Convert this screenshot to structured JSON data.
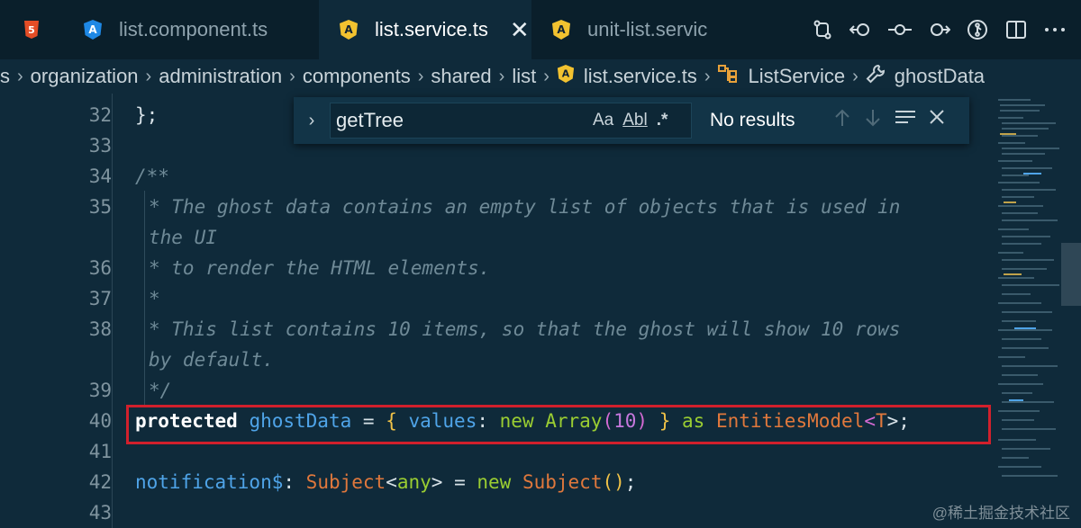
{
  "tabs": [
    {
      "label": "",
      "icon": "html5-icon"
    },
    {
      "label": "list.component.ts",
      "icon": "angular-icon"
    },
    {
      "label": "list.service.ts",
      "icon": "angular-icon",
      "active": true
    },
    {
      "label": "unit-list.servic",
      "icon": "angular-icon"
    }
  ],
  "tab_close": "✕",
  "breadcrumb": {
    "lead": "s",
    "items": [
      "organization",
      "administration",
      "components",
      "shared",
      "list",
      "list.service.ts",
      "ListService",
      "ghostData"
    ]
  },
  "find": {
    "query": "getTree",
    "opt_case": "Aa",
    "opt_word": "Abl",
    "opt_regex": ".*",
    "results": "No results"
  },
  "code": {
    "line32": "};",
    "line34": "/**",
    "line35a": "* The ghost data contains an empty list of objects that is used in",
    "line35b": "the UI",
    "line36": "* to render the HTML elements.",
    "line37": "*",
    "line38a": "* This list contains 10 items, so that the ghost will show 10 rows",
    "line38b": "by default.",
    "line39": "*/",
    "l40": {
      "kw": "protected",
      "name": "ghostData",
      "eq": " = ",
      "open": "{",
      "key": " values",
      "colon": ": ",
      "new": "new",
      "arr": " Array",
      "po": "(",
      "num": "10",
      "pc": ")",
      "close": " }",
      "as": " as",
      "type": " EntitiesModel",
      "lt": "<",
      "t": "T",
      "end": ">;"
    },
    "l42": {
      "name": "notification$",
      "colon": ": ",
      "type": "Subject",
      "lt": "<",
      "any": "any",
      "gt": ">",
      "eq": " = ",
      "new": "new",
      "type2": " Subject",
      "paren": "()",
      "end": ";"
    }
  },
  "line_numbers": [
    "32",
    "33",
    "34",
    "35",
    "36",
    "37",
    "38",
    "39",
    "40",
    "41",
    "42",
    "43"
  ],
  "watermark": "@稀土掘金技术社区"
}
